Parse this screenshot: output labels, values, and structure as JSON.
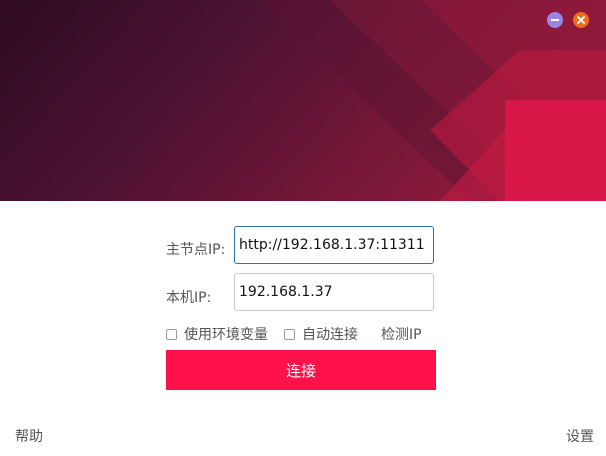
{
  "window": {
    "controls": {
      "minimize_icon": "minimize-icon",
      "close_icon": "close-icon",
      "minimize_color": "#9a86e6",
      "close_color": "#f06a1a"
    },
    "banner_colors": [
      "#3a0f27",
      "#6a1535",
      "#a81d3d",
      "#e0184a"
    ]
  },
  "form": {
    "master_ip_label": "主节点IP:",
    "master_ip_value": "http://192.168.1.37:11311",
    "local_ip_label": "本机IP:",
    "local_ip_value": "192.168.1.37",
    "use_env_var_label": "使用环境变量",
    "use_env_var_checked": false,
    "auto_connect_label": "自动连接",
    "auto_connect_checked": false,
    "detect_ip_label": "检测IP",
    "connect_button_label": "连接",
    "accent_color": "#ff1249"
  },
  "footer": {
    "help_label": "帮助",
    "settings_label": "设置"
  }
}
